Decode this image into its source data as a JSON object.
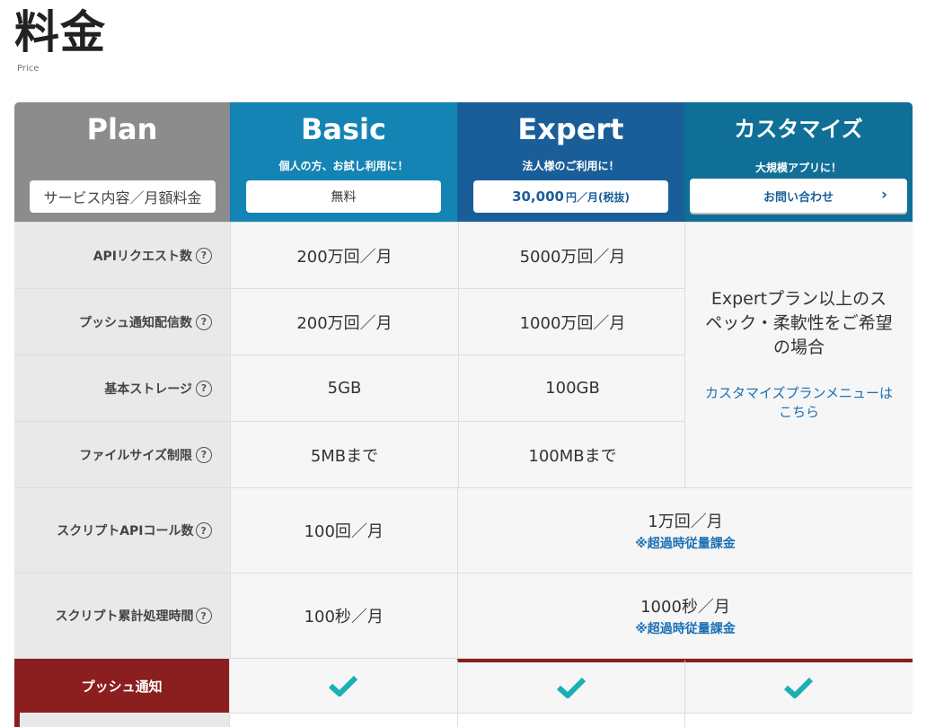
{
  "page": {
    "title": "料金",
    "subtitle": "Price"
  },
  "header": {
    "plan_label": "Plan",
    "plan_box": "サービス内容／月額料金",
    "basic": {
      "name": "Basic",
      "sub": "個人の方、お試し利用に！",
      "price": "無料"
    },
    "expert": {
      "name": "Expert",
      "sub": "法人様のご利用に！",
      "price_value": "30,000",
      "price_unit": "円／月(税抜)"
    },
    "custom": {
      "name": "カスタマイズ",
      "sub": "大規模アプリに！",
      "button": "お問い合わせ",
      "chevron": "›"
    }
  },
  "rows": [
    {
      "label": "APIリクエスト数",
      "basic": "200万回／月",
      "expert": "5000万回／月"
    },
    {
      "label": "プッシュ通知配信数",
      "basic": "200万回／月",
      "expert": "1000万回／月"
    },
    {
      "label": "基本ストレージ",
      "basic": "5GB",
      "expert": "100GB"
    },
    {
      "label": "ファイルサイズ制限",
      "basic": "5MBまで",
      "expert": "100MBまで"
    },
    {
      "label": "スクリプトAPIコール数",
      "basic": "100回／月",
      "merged": "1万回／月",
      "note": "※超過時従量課金"
    },
    {
      "label": "スクリプト累計処理時間",
      "basic": "100秒／月",
      "merged": "1000秒／月",
      "note": "※超過時従量課金"
    }
  ],
  "custom_cell": {
    "desc": "Expertプラン以上のスペック・柔軟性をご希望の場合",
    "link": "カスタマイズプランメニューはこちら"
  },
  "help_icon": "?",
  "push": {
    "label": "プッシュ通知",
    "basic": true,
    "expert": true,
    "custom": true
  },
  "colors": {
    "check": "#1ab0b5",
    "section_red": "#8b1e1e",
    "basic": "#1484b4",
    "expert": "#1a5e99",
    "custom": "#106f96"
  }
}
